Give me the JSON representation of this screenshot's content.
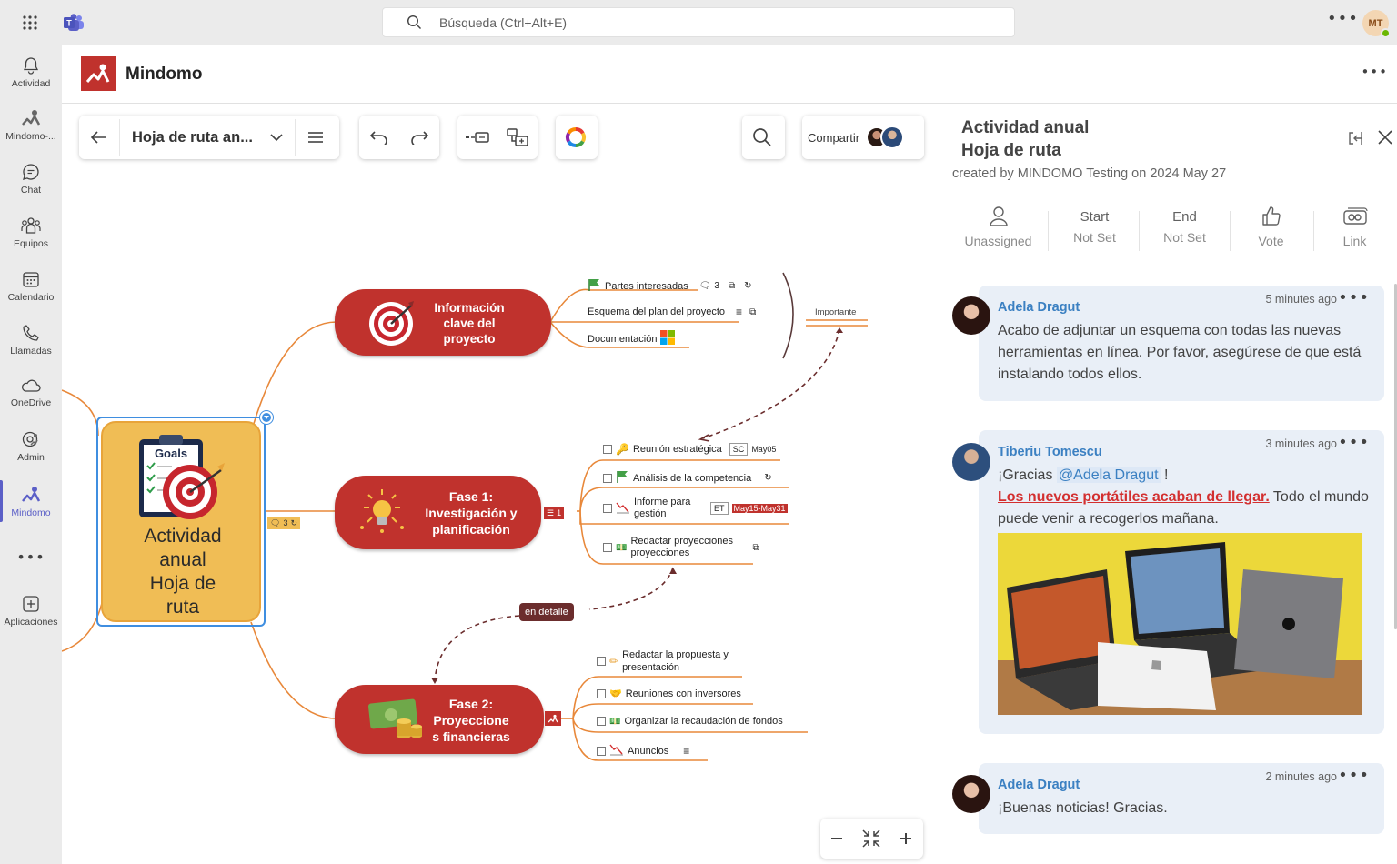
{
  "search": {
    "placeholder": "Búsqueda (Ctrl+Alt+E)"
  },
  "user": {
    "initials": "MT"
  },
  "rail": [
    {
      "id": "actividad",
      "label": "Actividad",
      "icon": "bell-icon"
    },
    {
      "id": "mindomo-app",
      "label": "Mindomo-...",
      "icon": "mindomo-icon"
    },
    {
      "id": "chat",
      "label": "Chat",
      "icon": "chat-icon"
    },
    {
      "id": "equipos",
      "label": "Equipos",
      "icon": "teams-icon"
    },
    {
      "id": "calendario",
      "label": "Calendario",
      "icon": "calendar-icon"
    },
    {
      "id": "llamadas",
      "label": "Llamadas",
      "icon": "phone-icon"
    },
    {
      "id": "onedrive",
      "label": "OneDrive",
      "icon": "cloud-icon"
    },
    {
      "id": "admin",
      "label": "Admin",
      "icon": "admin-icon"
    },
    {
      "id": "mindomo",
      "label": "Mindomo",
      "icon": "mindomo-icon",
      "active": true
    },
    {
      "id": "more",
      "label": "",
      "icon": "more-icon"
    },
    {
      "id": "aplicaciones",
      "label": "Aplicaciones",
      "icon": "add-app-icon"
    }
  ],
  "app": {
    "title": "Mindomo"
  },
  "toolbar": {
    "map_title": "Hoja de ruta an...",
    "share_label": "Compartir"
  },
  "map": {
    "central": {
      "title_lines": [
        "Actividad",
        "anual",
        "Hoja de",
        "ruta"
      ],
      "clipboard_label": "Goals",
      "comment_count": "3"
    },
    "nodes": [
      {
        "id": "info",
        "lines": [
          "Información",
          "clave del",
          "proyecto"
        ]
      },
      {
        "id": "fase1",
        "lines": [
          "Fase 1:",
          "Investigación y",
          "planificación"
        ]
      },
      {
        "id": "fase2",
        "lines": [
          "Fase 2:",
          "Proyeccione",
          "s financieras"
        ]
      }
    ],
    "info_leaves": [
      {
        "text": "Partes interesadas",
        "comment_count": "3"
      },
      {
        "text": "Esquema del plan del proyecto"
      },
      {
        "text": "Documentación"
      }
    ],
    "boundary_label": "Importante",
    "fase1_leaves": [
      {
        "text": "Reunión estratégica",
        "tag": "SC",
        "date": "May05"
      },
      {
        "text": "Análisis de la competencia"
      },
      {
        "text": "Informe para gestión",
        "tag": "ET",
        "date": "May15-May31"
      },
      {
        "text": "Redactar proyecciones proyecciones"
      }
    ],
    "fase1_task_count": "1",
    "relation_label": "en detalle",
    "fase2_leaves": [
      {
        "text": "Redactar la propuesta y presentación"
      },
      {
        "text": "Reuniones con inversores"
      },
      {
        "text": "Organizar la recaudación de fondos"
      },
      {
        "text": "Anuncios"
      }
    ]
  },
  "panel": {
    "title_line1": "Actividad anual",
    "title_line2": "Hoja de ruta",
    "created": "created by MINDOMO Testing on 2024 May 27",
    "actions": [
      {
        "label": "Unassigned",
        "sub": ""
      },
      {
        "label": "Start",
        "sub": "Not Set"
      },
      {
        "label": "End",
        "sub": "Not Set"
      },
      {
        "label": "Vote",
        "sub": ""
      },
      {
        "label": "Link",
        "sub": ""
      }
    ],
    "comments": [
      {
        "author": "Adela Dragut",
        "time": "5 minutes ago",
        "text": "Acabo de adjuntar un esquema con todas las nuevas herramientas en línea. Por favor, asegúrese de que está instalando todos ellos."
      },
      {
        "author": "Tiberiu Tomescu",
        "time": "3 minutes ago",
        "text_prefix": "¡Gracias",
        "mention": "@Adela Dragut",
        "text_after_mention": "!",
        "link": "Los nuevos portátiles acaban de llegar.",
        "text_after_link": " Todo el mundo puede venir a recogerlos mañana."
      },
      {
        "author": "Adela Dragut",
        "time": "2 minutes ago",
        "text": "¡Buenas noticias! Gracias."
      }
    ]
  },
  "colors": {
    "rail_bg": "#ebebeb",
    "accent": "#5b5fc7",
    "node_red": "#c0322d",
    "central_fill": "#f0bd55",
    "branch": "#e8883a",
    "link_blue": "#3b80c2",
    "comment_bg": "#e9eff7"
  }
}
